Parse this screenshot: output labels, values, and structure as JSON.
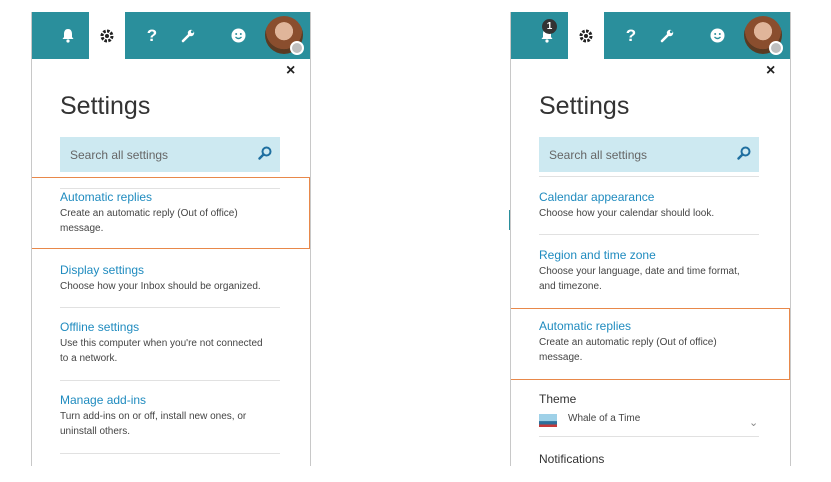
{
  "colors": {
    "nav_bg": "#2a8f9c",
    "link": "#1f8bbf",
    "search_bg": "#cde9f1",
    "highlight": "#e8884a"
  },
  "left_panel": {
    "nav": {
      "icons": [
        "bell-icon",
        "gear-icon",
        "help-icon",
        "wrench-icon",
        "smiley-icon",
        "avatar"
      ],
      "active": "gear-icon"
    },
    "close": "×",
    "title": "Settings",
    "search": {
      "placeholder": "Search all settings"
    },
    "items": [
      {
        "title": "Automatic replies",
        "desc_line1": "Create an automatic reply (Out of office)",
        "desc_line2": "message.",
        "highlighted": true
      },
      {
        "title": "Display settings",
        "desc_line1": "Choose how your Inbox should be organized.",
        "desc_line2": ""
      },
      {
        "title": "Offline settings",
        "desc_line1": "Use this computer when you're not connected",
        "desc_line2": "to a network."
      },
      {
        "title": "Manage add-ins",
        "desc_line1": "Turn add-ins on or off, install new ones, or",
        "desc_line2": "uninstall others."
      }
    ]
  },
  "right_panel": {
    "nav": {
      "icons": [
        "bell-icon",
        "gear-icon",
        "help-icon",
        "wrench-icon",
        "smiley-icon",
        "avatar"
      ],
      "active": "gear-icon",
      "notification_count": "1"
    },
    "close": "×",
    "title": "Settings",
    "search": {
      "placeholder": "Search all settings"
    },
    "items": [
      {
        "title": "Calendar appearance",
        "desc_line1": "Choose how your calendar should look.",
        "desc_line2": ""
      },
      {
        "title": "Region and time zone",
        "desc_line1": "Choose your language, date and time format,",
        "desc_line2": "and timezone."
      },
      {
        "title": "Automatic replies",
        "desc_line1": "Create an automatic reply (Out of office)",
        "desc_line2": "message.",
        "highlighted": true
      }
    ],
    "theme": {
      "label": "Theme",
      "value": "Whale of a Time"
    },
    "notifications_label": "Notifications"
  }
}
